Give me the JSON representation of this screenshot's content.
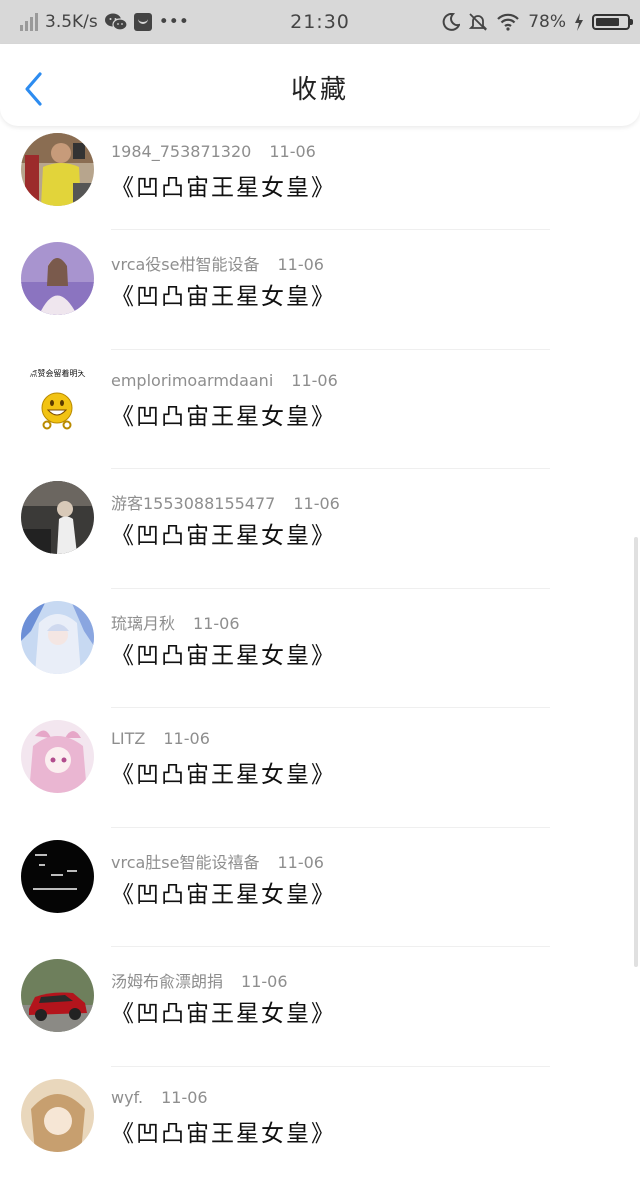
{
  "status_bar": {
    "network_speed": "3.5K/s",
    "more": "•••",
    "time": "21:30",
    "battery_percent": "78%",
    "battery_level": 0.78,
    "icons": [
      "signal-icon",
      "wechat-icon",
      "notification-app-icon",
      "more-icon",
      "moon-icon",
      "mute-bell-icon",
      "wifi-icon",
      "charging-icon",
      "battery-icon"
    ]
  },
  "header": {
    "title": "收藏",
    "back_icon": "chevron-left-icon",
    "accent_color": "#2d8cf0"
  },
  "list": [
    {
      "user": "1984_753871320",
      "date": "11-06",
      "title": "《凹凸宙王星女皇》",
      "avatar": "person-yellow-shirt"
    },
    {
      "user": "vrca役se柑智能设备",
      "date": "11-06",
      "title": "《凹凸宙王星女皇》",
      "avatar": "girl-lavender"
    },
    {
      "user": "emplorimoarmdaani",
      "date": "11-06",
      "title": "《凹凸宙王星女皇》",
      "avatar": "emoji-face",
      "avatar_text": "点赞会留着明天"
    },
    {
      "user": "游客1553088155477",
      "date": "11-06",
      "title": "《凹凸宙王星女皇》",
      "avatar": "dark-photo"
    },
    {
      "user": "琉璃月秋",
      "date": "11-06",
      "title": "《凹凸宙王星女皇》",
      "avatar": "anime-blue"
    },
    {
      "user": "LITZ",
      "date": "11-06",
      "title": "《凹凸宙王星女皇》",
      "avatar": "anime-pink"
    },
    {
      "user": "vrca肚se智能设禧备",
      "date": "11-06",
      "title": "《凹凸宙王星女皇》",
      "avatar": "black-text"
    },
    {
      "user": "汤姆布兪漂朗捐",
      "date": "11-06",
      "title": "《凹凸宙王星女皇》",
      "avatar": "red-car"
    },
    {
      "user": "wyf.",
      "date": "11-06",
      "title": "《凹凸宙王星女皇》",
      "avatar": "anime-beige"
    }
  ]
}
